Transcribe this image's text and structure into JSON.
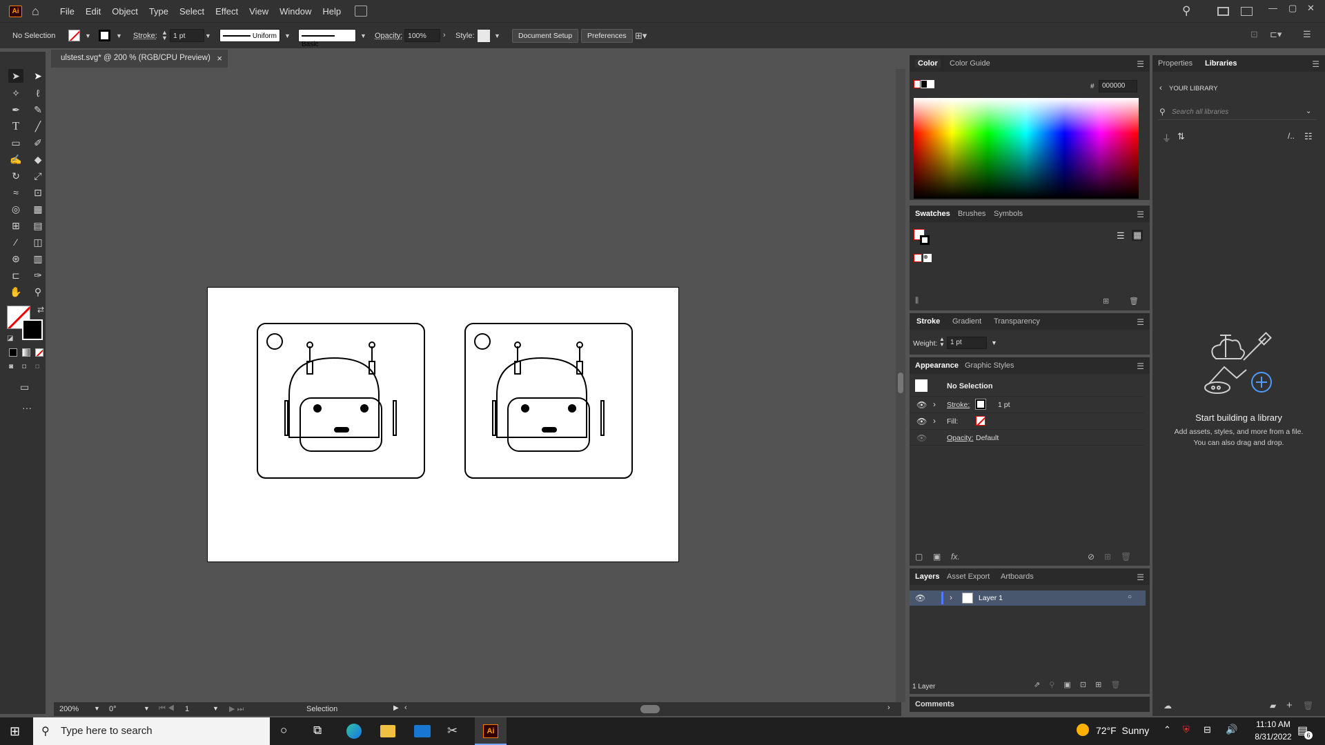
{
  "app": {
    "logo": "Ai",
    "colors": {
      "accent": "#ff9a00",
      "selected_layer": "#48576e",
      "canvas": "#535353",
      "panel": "#323232"
    }
  },
  "menu": [
    "File",
    "Edit",
    "Object",
    "Type",
    "Select",
    "Effect",
    "View",
    "Window",
    "Help"
  ],
  "control_bar": {
    "selection": "No Selection",
    "stroke_label": "Stroke:",
    "stroke_value": "1 pt",
    "profile": "Uniform",
    "brush": "Basic",
    "opacity_label": "Opacity:",
    "opacity_value": "100%",
    "style_label": "Style:",
    "document_setup": "Document Setup",
    "preferences": "Preferences"
  },
  "document": {
    "tab_title": "ulstest.svg* @ 200 % (RGB/CPU Preview)",
    "close": "×"
  },
  "status_bar": {
    "zoom": "200%",
    "rotation": "0°",
    "artboard": "1",
    "tool": "Selection"
  },
  "color_panel": {
    "tabs": [
      "Color",
      "Color Guide"
    ],
    "hex_label": "#",
    "hex_value": "000000"
  },
  "swatches_panel": {
    "tabs": [
      "Swatches",
      "Brushes",
      "Symbols"
    ]
  },
  "stroke_panel": {
    "tabs": [
      "Stroke",
      "Gradient",
      "Transparency"
    ],
    "weight_label": "Weight:",
    "weight_value": "1 pt"
  },
  "appearance_panel": {
    "tabs": [
      "Appearance",
      "Graphic Styles"
    ],
    "title": "No Selection",
    "rows": [
      {
        "label": "Stroke:",
        "value": "1 pt"
      },
      {
        "label": "Fill:",
        "value": ""
      },
      {
        "label": "Opacity:",
        "value": "Default"
      }
    ],
    "fx": "fx."
  },
  "layers_panel": {
    "tabs": [
      "Layers",
      "Asset Export",
      "Artboards"
    ],
    "layer_name": "Layer 1",
    "count": "1 Layer"
  },
  "comments": {
    "label": "Comments"
  },
  "libraries_panel": {
    "tabs": [
      "Properties",
      "Libraries"
    ],
    "your_library": "YOUR LIBRARY",
    "search_placeholder": "Search all libraries",
    "headline": "Start building a library",
    "desc_line1": "Add assets, styles, and more from a file.",
    "desc_line2": "You can also drag and drop."
  },
  "taskbar": {
    "search_placeholder": "Type here to search",
    "weather": "72°F  Sunny",
    "time": "11:10 AM",
    "date": "8/31/2022",
    "notification_count": "6"
  }
}
